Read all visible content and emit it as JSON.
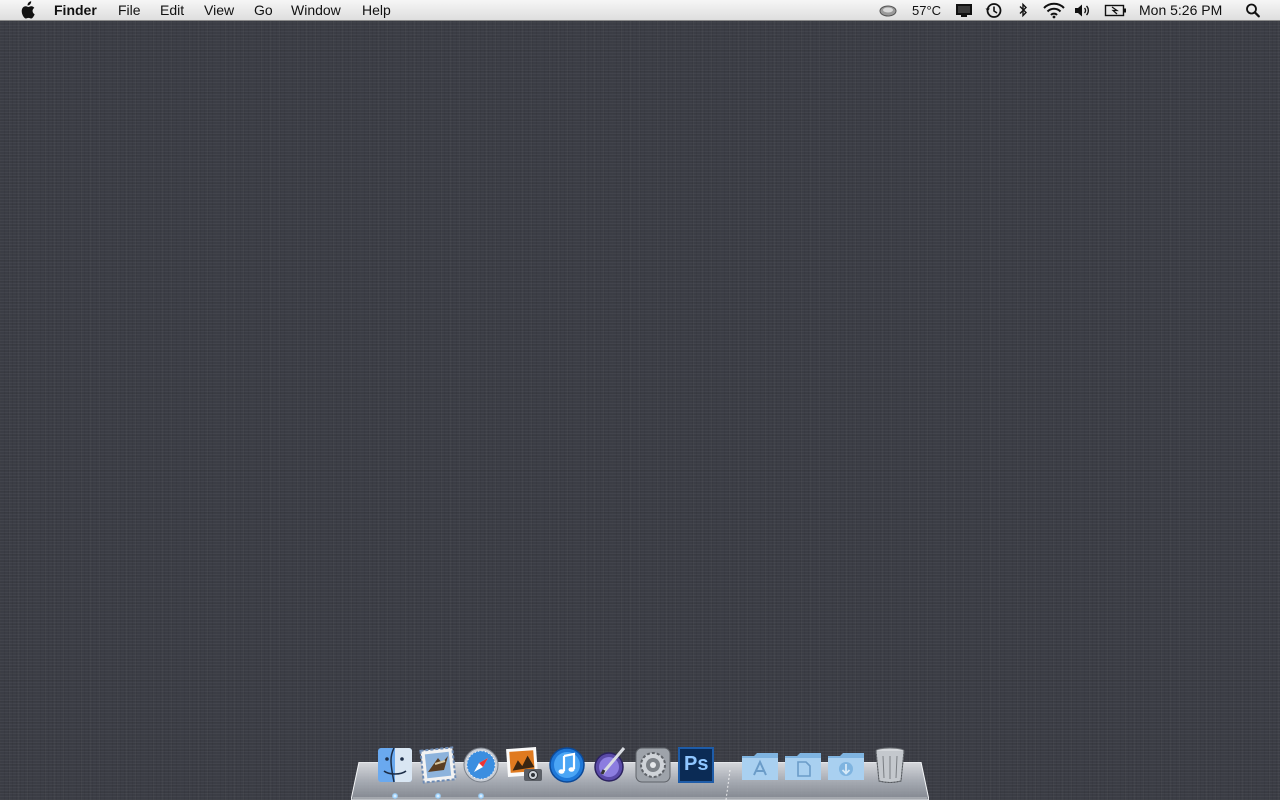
{
  "menubar": {
    "apple_icon": "apple-icon",
    "app_name": "Finder",
    "menus": [
      "File",
      "Edit",
      "View",
      "Go",
      "Window",
      "Help"
    ],
    "status": {
      "temperature": "57°C",
      "clock": "Mon 5:26 PM",
      "icons": [
        "temperature-monitor-icon",
        "display-icon",
        "time-machine-icon",
        "bluetooth-icon",
        "wifi-icon",
        "volume-icon",
        "battery-icon",
        "spotlight-search-icon"
      ]
    }
  },
  "desktop": {
    "wallpaper": "dark linen",
    "color": "#3b3d45"
  },
  "dock": {
    "apps": [
      {
        "icon": "finder-icon",
        "running": true
      },
      {
        "icon": "mail-icon",
        "running": true
      },
      {
        "icon": "safari-icon",
        "running": true
      },
      {
        "icon": "iphoto-icon",
        "running": false
      },
      {
        "icon": "itunes-icon",
        "running": false
      },
      {
        "icon": "keynote-icon",
        "running": false
      },
      {
        "icon": "system-preferences-icon",
        "running": false
      },
      {
        "icon": "photoshop-icon",
        "label": "Ps",
        "running": false
      }
    ],
    "stacks": [
      {
        "icon": "applications-folder-icon"
      },
      {
        "icon": "documents-folder-icon"
      },
      {
        "icon": "downloads-folder-icon"
      }
    ],
    "trash": {
      "icon": "trash-icon"
    }
  }
}
